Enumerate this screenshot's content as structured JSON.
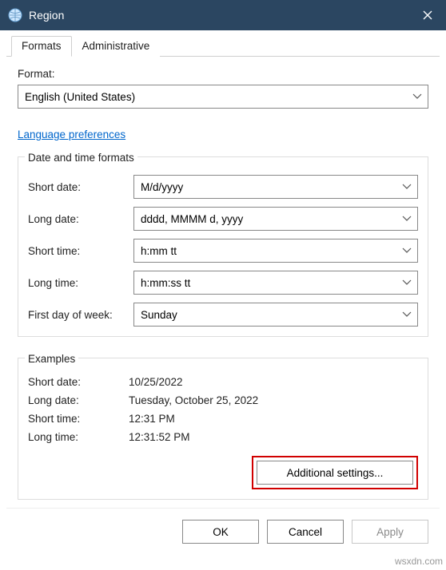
{
  "window": {
    "title": "Region",
    "tabs": {
      "formats": "Formats",
      "administrative": "Administrative"
    }
  },
  "formats": {
    "format_label": "Format:",
    "format_value": "English (United States)",
    "language_preferences_link": "Language preferences",
    "group_title": "Date and time formats",
    "fields": {
      "short_date_label": "Short date:",
      "short_date_value": "M/d/yyyy",
      "long_date_label": "Long date:",
      "long_date_value": "dddd, MMMM d, yyyy",
      "short_time_label": "Short time:",
      "short_time_value": "h:mm tt",
      "long_time_label": "Long time:",
      "long_time_value": "h:mm:ss tt",
      "first_day_label": "First day of week:",
      "first_day_value": "Sunday"
    },
    "examples": {
      "group_title": "Examples",
      "short_date_label": "Short date:",
      "short_date_value": "10/25/2022",
      "long_date_label": "Long date:",
      "long_date_value": "Tuesday, October 25, 2022",
      "short_time_label": "Short time:",
      "short_time_value": "12:31 PM",
      "long_time_label": "Long time:",
      "long_time_value": "12:31:52 PM"
    },
    "additional_settings_button": "Additional settings..."
  },
  "footer": {
    "ok": "OK",
    "cancel": "Cancel",
    "apply": "Apply"
  },
  "watermark": "wsxdn.com"
}
